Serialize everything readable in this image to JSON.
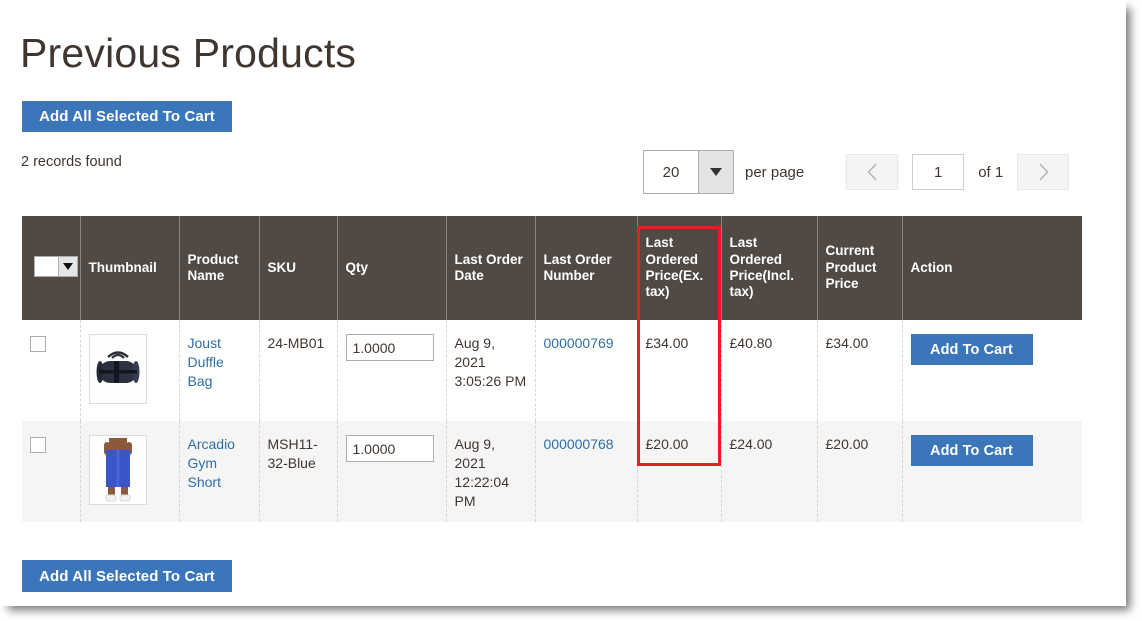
{
  "page": {
    "title": "Previous Products",
    "records_found": "2 records found",
    "top_button_label": "Add All Selected To Cart",
    "bottom_button_label": "Add All Selected To Cart"
  },
  "toolbar": {
    "per_page_value": "20",
    "per_page_label": "per page",
    "per_page_options": [
      "20"
    ],
    "prev_icon": "chevron-left-icon",
    "next_icon": "chevron-right-icon",
    "current_page": "1",
    "of_label": "of 1"
  },
  "grid": {
    "columns": [
      {
        "key": "select",
        "label": ""
      },
      {
        "key": "thumbnail",
        "label": "Thumbnail"
      },
      {
        "key": "product_name",
        "label": "Product Name"
      },
      {
        "key": "sku",
        "label": "SKU"
      },
      {
        "key": "qty",
        "label": "Qty"
      },
      {
        "key": "last_order_date",
        "label": "Last Order Date"
      },
      {
        "key": "last_order_number",
        "label": "Last Order Number"
      },
      {
        "key": "last_ordered_price_ex_tax",
        "label": "Last Ordered Price(Ex. tax)"
      },
      {
        "key": "last_ordered_price_incl_tax",
        "label": "Last Ordered Price(Incl. tax)"
      },
      {
        "key": "current_product_price",
        "label": "Current Product Price"
      },
      {
        "key": "action",
        "label": "Action"
      }
    ],
    "rows": [
      {
        "product_name": "Joust Duffle Bag",
        "thumbnail_alt": "joust-duffle-bag-thumbnail",
        "sku": "24-MB01",
        "qty": "1.0000",
        "last_order_date": "Aug 9, 2021 3:05:26 PM",
        "last_order_number": "000000769",
        "last_ordered_price_ex_tax": "£34.00",
        "last_ordered_price_incl_tax": "£40.80",
        "current_product_price": "£34.00",
        "action_label": "Add To Cart"
      },
      {
        "product_name": "Arcadio Gym Short",
        "thumbnail_alt": "arcadio-gym-short-thumbnail",
        "sku": "MSH11-32-Blue",
        "qty": "1.0000",
        "last_order_date": "Aug 9, 2021 12:22:04 PM",
        "last_order_number": "000000768",
        "last_ordered_price_ex_tax": "£20.00",
        "last_ordered_price_incl_tax": "£24.00",
        "current_product_price": "£20.00",
        "action_label": "Add To Cart"
      }
    ]
  },
  "annotation": {
    "highlight_color": "#ee1b24",
    "highlight_target": "Last Ordered Price(Ex. tax)"
  },
  "colors": {
    "primary_button": "#3a76b9",
    "header_row": "#514943",
    "link": "#2f6ea5",
    "title_text": "#41362f"
  }
}
